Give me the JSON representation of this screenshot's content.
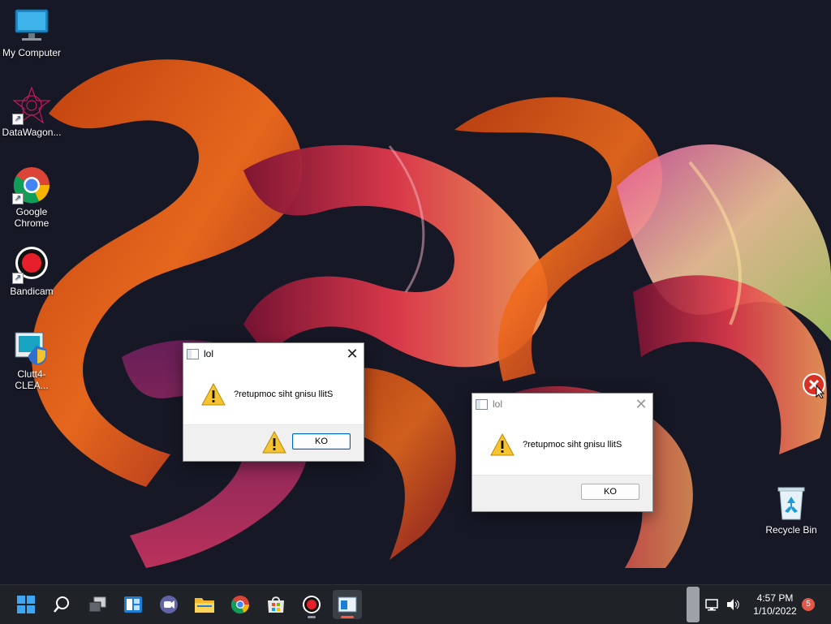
{
  "desktop": {
    "icons": [
      {
        "label": "My Computer",
        "icon": "monitor-icon"
      },
      {
        "label": "DataWagon...",
        "icon": "datawagon-icon"
      },
      {
        "label": "Google Chrome",
        "icon": "chrome-icon"
      },
      {
        "label": "Bandicam",
        "icon": "record-icon"
      },
      {
        "label": "Clutt4-CLEA...",
        "icon": "clutt4-icon"
      },
      {
        "label": "Recycle Bin",
        "icon": "recycle-bin-icon"
      }
    ]
  },
  "dialogs": [
    {
      "title": "lol",
      "message": "?retupmoc siht gnisu llitS",
      "button": "KO",
      "close": "✕"
    },
    {
      "title": "lol",
      "message": "?retupmoc siht gnisu llitS",
      "button": "KO",
      "close": "✕"
    }
  ],
  "taskbar": {
    "items": [
      "start-icon",
      "search-icon",
      "task-view-icon",
      "widgets-icon",
      "teams-chat-icon",
      "file-explorer-icon",
      "chrome-icon",
      "store-icon",
      "bandicam-icon",
      "active-app-icon"
    ],
    "clock": {
      "time": "4:57 PM",
      "date": "1/10/2022"
    },
    "notifications": "5"
  },
  "colors": {
    "accent": "#0067c0",
    "taskbar": "#1f2328",
    "badge": "#e4584a"
  }
}
